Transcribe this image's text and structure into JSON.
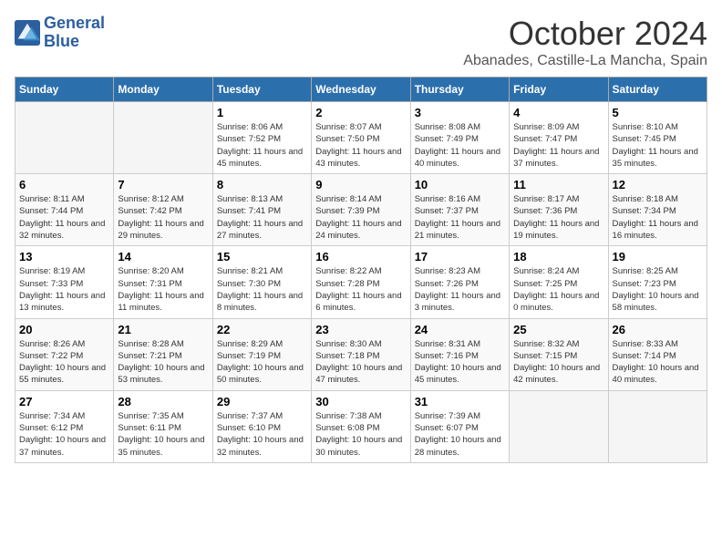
{
  "logo": {
    "line1": "General",
    "line2": "Blue"
  },
  "title": "October 2024",
  "subtitle": "Abanades, Castille-La Mancha, Spain",
  "headers": [
    "Sunday",
    "Monday",
    "Tuesday",
    "Wednesday",
    "Thursday",
    "Friday",
    "Saturday"
  ],
  "weeks": [
    [
      {
        "day": "",
        "info": ""
      },
      {
        "day": "",
        "info": ""
      },
      {
        "day": "1",
        "info": "Sunrise: 8:06 AM\nSunset: 7:52 PM\nDaylight: 11 hours and 45 minutes."
      },
      {
        "day": "2",
        "info": "Sunrise: 8:07 AM\nSunset: 7:50 PM\nDaylight: 11 hours and 43 minutes."
      },
      {
        "day": "3",
        "info": "Sunrise: 8:08 AM\nSunset: 7:49 PM\nDaylight: 11 hours and 40 minutes."
      },
      {
        "day": "4",
        "info": "Sunrise: 8:09 AM\nSunset: 7:47 PM\nDaylight: 11 hours and 37 minutes."
      },
      {
        "day": "5",
        "info": "Sunrise: 8:10 AM\nSunset: 7:45 PM\nDaylight: 11 hours and 35 minutes."
      }
    ],
    [
      {
        "day": "6",
        "info": "Sunrise: 8:11 AM\nSunset: 7:44 PM\nDaylight: 11 hours and 32 minutes."
      },
      {
        "day": "7",
        "info": "Sunrise: 8:12 AM\nSunset: 7:42 PM\nDaylight: 11 hours and 29 minutes."
      },
      {
        "day": "8",
        "info": "Sunrise: 8:13 AM\nSunset: 7:41 PM\nDaylight: 11 hours and 27 minutes."
      },
      {
        "day": "9",
        "info": "Sunrise: 8:14 AM\nSunset: 7:39 PM\nDaylight: 11 hours and 24 minutes."
      },
      {
        "day": "10",
        "info": "Sunrise: 8:16 AM\nSunset: 7:37 PM\nDaylight: 11 hours and 21 minutes."
      },
      {
        "day": "11",
        "info": "Sunrise: 8:17 AM\nSunset: 7:36 PM\nDaylight: 11 hours and 19 minutes."
      },
      {
        "day": "12",
        "info": "Sunrise: 8:18 AM\nSunset: 7:34 PM\nDaylight: 11 hours and 16 minutes."
      }
    ],
    [
      {
        "day": "13",
        "info": "Sunrise: 8:19 AM\nSunset: 7:33 PM\nDaylight: 11 hours and 13 minutes."
      },
      {
        "day": "14",
        "info": "Sunrise: 8:20 AM\nSunset: 7:31 PM\nDaylight: 11 hours and 11 minutes."
      },
      {
        "day": "15",
        "info": "Sunrise: 8:21 AM\nSunset: 7:30 PM\nDaylight: 11 hours and 8 minutes."
      },
      {
        "day": "16",
        "info": "Sunrise: 8:22 AM\nSunset: 7:28 PM\nDaylight: 11 hours and 6 minutes."
      },
      {
        "day": "17",
        "info": "Sunrise: 8:23 AM\nSunset: 7:26 PM\nDaylight: 11 hours and 3 minutes."
      },
      {
        "day": "18",
        "info": "Sunrise: 8:24 AM\nSunset: 7:25 PM\nDaylight: 11 hours and 0 minutes."
      },
      {
        "day": "19",
        "info": "Sunrise: 8:25 AM\nSunset: 7:23 PM\nDaylight: 10 hours and 58 minutes."
      }
    ],
    [
      {
        "day": "20",
        "info": "Sunrise: 8:26 AM\nSunset: 7:22 PM\nDaylight: 10 hours and 55 minutes."
      },
      {
        "day": "21",
        "info": "Sunrise: 8:28 AM\nSunset: 7:21 PM\nDaylight: 10 hours and 53 minutes."
      },
      {
        "day": "22",
        "info": "Sunrise: 8:29 AM\nSunset: 7:19 PM\nDaylight: 10 hours and 50 minutes."
      },
      {
        "day": "23",
        "info": "Sunrise: 8:30 AM\nSunset: 7:18 PM\nDaylight: 10 hours and 47 minutes."
      },
      {
        "day": "24",
        "info": "Sunrise: 8:31 AM\nSunset: 7:16 PM\nDaylight: 10 hours and 45 minutes."
      },
      {
        "day": "25",
        "info": "Sunrise: 8:32 AM\nSunset: 7:15 PM\nDaylight: 10 hours and 42 minutes."
      },
      {
        "day": "26",
        "info": "Sunrise: 8:33 AM\nSunset: 7:14 PM\nDaylight: 10 hours and 40 minutes."
      }
    ],
    [
      {
        "day": "27",
        "info": "Sunrise: 7:34 AM\nSunset: 6:12 PM\nDaylight: 10 hours and 37 minutes."
      },
      {
        "day": "28",
        "info": "Sunrise: 7:35 AM\nSunset: 6:11 PM\nDaylight: 10 hours and 35 minutes."
      },
      {
        "day": "29",
        "info": "Sunrise: 7:37 AM\nSunset: 6:10 PM\nDaylight: 10 hours and 32 minutes."
      },
      {
        "day": "30",
        "info": "Sunrise: 7:38 AM\nSunset: 6:08 PM\nDaylight: 10 hours and 30 minutes."
      },
      {
        "day": "31",
        "info": "Sunrise: 7:39 AM\nSunset: 6:07 PM\nDaylight: 10 hours and 28 minutes."
      },
      {
        "day": "",
        "info": ""
      },
      {
        "day": "",
        "info": ""
      }
    ]
  ]
}
